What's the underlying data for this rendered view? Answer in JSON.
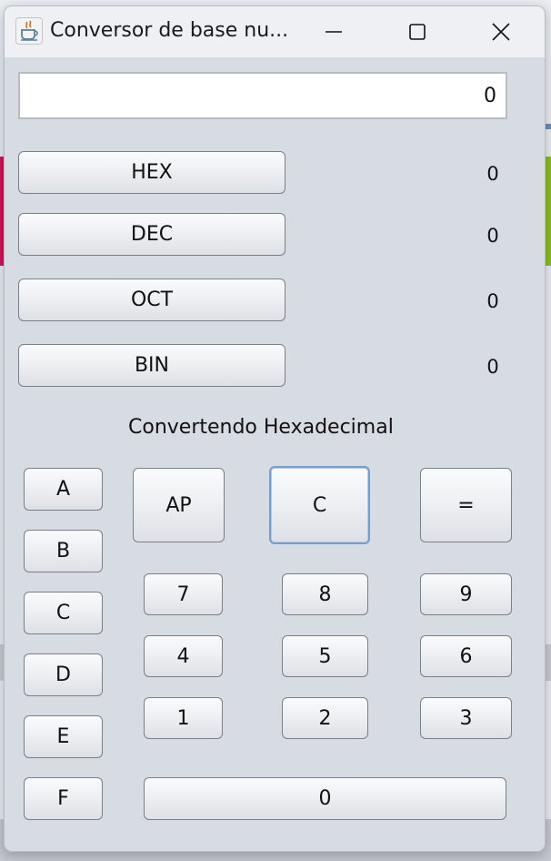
{
  "window": {
    "title": "Conversor de base nu...",
    "app_icon": "java-cup-icon",
    "controls": [
      "minimize-icon",
      "maximize-icon",
      "close-icon"
    ]
  },
  "display": {
    "value": "0"
  },
  "bases": [
    {
      "label": "HEX",
      "value": "0"
    },
    {
      "label": "DEC",
      "value": "0"
    },
    {
      "label": "OCT",
      "value": "0"
    },
    {
      "label": "BIN",
      "value": "0"
    }
  ],
  "status": "Convertendo Hexadecimal",
  "letters": [
    "A",
    "B",
    "C",
    "D",
    "E",
    "F"
  ],
  "ops": {
    "ap": "AP",
    "clear": "C",
    "equals": "="
  },
  "digits": {
    "d7": "7",
    "d8": "8",
    "d9": "9",
    "d4": "4",
    "d5": "5",
    "d6": "6",
    "d1": "1",
    "d2": "2",
    "d3": "3",
    "d0": "0"
  }
}
